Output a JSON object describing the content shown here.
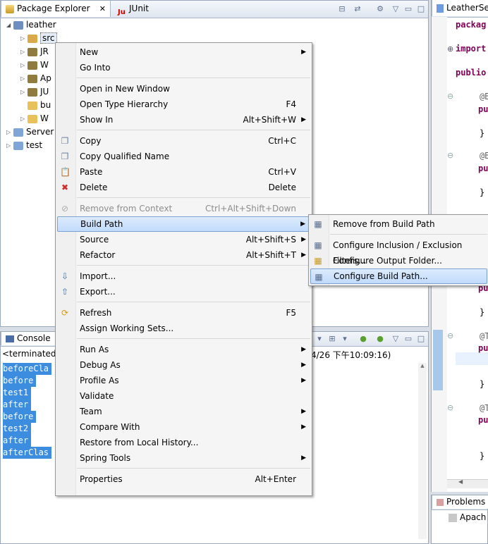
{
  "package_explorer": {
    "tab_label": "Package Explorer",
    "junit_tab_label": "JUnit",
    "tree": [
      {
        "label": "leather"
      },
      {
        "label": "src"
      },
      {
        "label": "JR"
      },
      {
        "label": "W"
      },
      {
        "label": "Ap"
      },
      {
        "label": "JU"
      },
      {
        "label": "bu"
      },
      {
        "label": "W"
      },
      {
        "label": "Server"
      },
      {
        "label": "test"
      }
    ]
  },
  "console": {
    "tab_label": "Console",
    "status": "<terminated>",
    "timestamp": "4/26 下午10:09:16)",
    "lines": [
      "beforeCla",
      "before",
      "test1",
      "after",
      "before",
      "test2",
      "after",
      "afterClas"
    ]
  },
  "editor": {
    "tab_label": "LeatherSe",
    "lines": [
      "packag",
      "import",
      "publio",
      "@B",
      "pu",
      "}",
      "@B",
      "pu",
      "}",
      "pu",
      "}",
      "@T",
      "pu",
      "}",
      "@T",
      "pu",
      "}"
    ]
  },
  "problems": {
    "tab_label": "Problems",
    "item": "Apach"
  },
  "context_menu": {
    "items": [
      {
        "label": "New",
        "submenu": true
      },
      {
        "label": "Go Into"
      },
      {
        "label": "Open in New Window"
      },
      {
        "label": "Open Type Hierarchy",
        "shortcut": "F4"
      },
      {
        "label": "Show In",
        "shortcut": "Alt+Shift+W",
        "submenu": true
      },
      {
        "label": "Copy",
        "shortcut": "Ctrl+C"
      },
      {
        "label": "Copy Qualified Name"
      },
      {
        "label": "Paste",
        "shortcut": "Ctrl+V"
      },
      {
        "label": "Delete",
        "shortcut": "Delete"
      },
      {
        "label": "Remove from Context",
        "shortcut": "Ctrl+Alt+Shift+Down",
        "disabled": true
      },
      {
        "label": "Build Path",
        "submenu": true,
        "highlighted": true
      },
      {
        "label": "Source",
        "shortcut": "Alt+Shift+S",
        "submenu": true
      },
      {
        "label": "Refactor",
        "shortcut": "Alt+Shift+T",
        "submenu": true
      },
      {
        "label": "Import..."
      },
      {
        "label": "Export..."
      },
      {
        "label": "Refresh",
        "shortcut": "F5"
      },
      {
        "label": "Assign Working Sets..."
      },
      {
        "label": "Run As",
        "submenu": true
      },
      {
        "label": "Debug As",
        "submenu": true
      },
      {
        "label": "Profile As",
        "submenu": true
      },
      {
        "label": "Validate"
      },
      {
        "label": "Team",
        "submenu": true
      },
      {
        "label": "Compare With",
        "submenu": true
      },
      {
        "label": "Restore from Local History..."
      },
      {
        "label": "Spring Tools",
        "submenu": true
      },
      {
        "label": "Properties",
        "shortcut": "Alt+Enter"
      }
    ]
  },
  "build_path_submenu": {
    "items": [
      {
        "label": "Remove from Build Path"
      },
      {
        "label": "Configure Inclusion / Exclusion Filters..."
      },
      {
        "label": "Configure Output Folder..."
      },
      {
        "label": "Configure Build Path...",
        "highlighted": true
      }
    ]
  },
  "colors": {
    "selection": "#3c8de0",
    "menu_highlight": "#c1dbfc",
    "keyword": "#7f0055"
  }
}
